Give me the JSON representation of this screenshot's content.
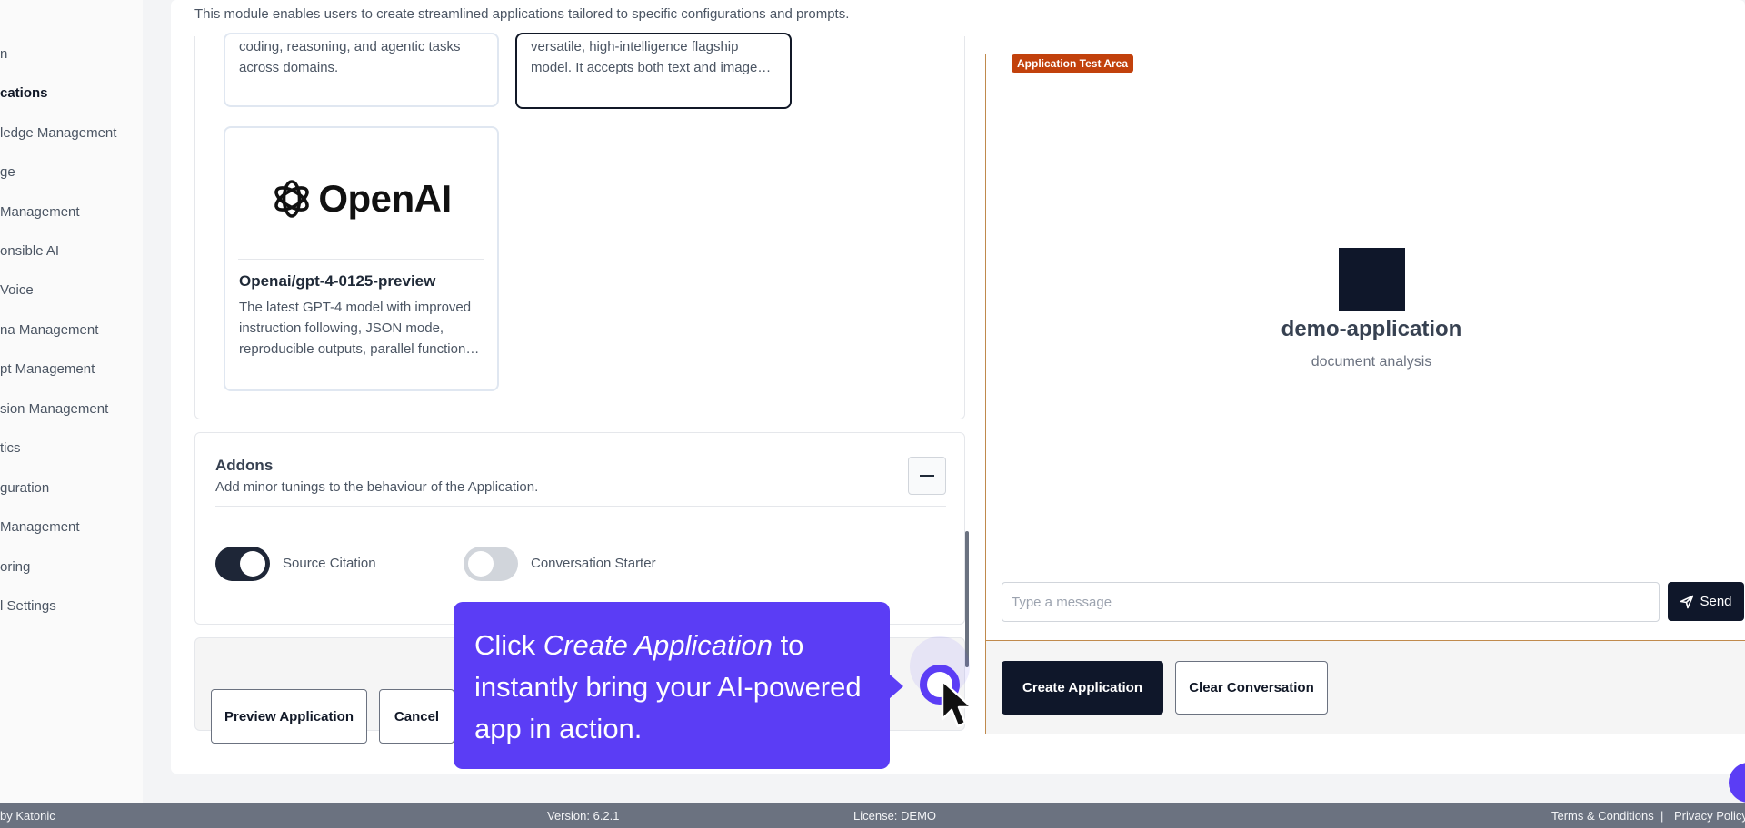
{
  "header": {
    "description": "This module enables users to create streamlined applications tailored to specific configurations and prompts."
  },
  "sidebar": {
    "items": [
      {
        "label": "n"
      },
      {
        "label": "cations"
      },
      {
        "label": "ledge Management"
      },
      {
        "label": "ge"
      },
      {
        "label": "Management"
      },
      {
        "label": "onsible AI"
      },
      {
        "label": "Voice"
      },
      {
        "label": "na Management"
      },
      {
        "label": "pt Management"
      },
      {
        "label": "sion Management"
      },
      {
        "label": "tics"
      },
      {
        "label": "guration"
      },
      {
        "label": "Management"
      },
      {
        "label": "oring"
      },
      {
        "label": "l Settings"
      }
    ]
  },
  "models": {
    "card1": {
      "line1": "coding, reasoning, and agentic tasks",
      "line2": "across domains."
    },
    "card2": {
      "line1": "versatile, high-intelligence flagship",
      "line2": "model. It accepts both text and image…"
    },
    "card3": {
      "logo_text": "OpenAI",
      "title": "Openai/gpt-4-0125-preview",
      "line1": "The latest GPT-4 model with improved",
      "line2": "instruction following, JSON mode,",
      "line3": "reproducible outputs, parallel function…"
    }
  },
  "addons": {
    "title": "Addons",
    "subtitle": "Add minor tunings to the behaviour of the Application.",
    "toggle1_label": "Source Citation",
    "toggle1_on": true,
    "toggle2_label": "Conversation Starter",
    "toggle2_on": false
  },
  "actions": {
    "preview_label": "Preview Application",
    "cancel_label": "Cancel"
  },
  "test_area": {
    "tag": "Application Test Area",
    "app_name": "demo-application",
    "app_description": "document analysis",
    "input_placeholder": "Type a message",
    "send_label": "Send",
    "create_label": "Create Application",
    "clear_label": "Clear Conversation"
  },
  "tooltip": {
    "prefix": "Click ",
    "emphasis": "Create Application",
    "suffix": " to instantly bring your AI-powered app in action."
  },
  "footer": {
    "left": "by Katonic",
    "version": "Version: 6.2.1",
    "license": "License: DEMO",
    "terms": "Terms & Conditions",
    "separator": "|",
    "privacy": "Privacy Policy"
  },
  "colors": {
    "accent": "#5b3df5",
    "dark": "#0f172a",
    "test_tag": "#c2410c"
  }
}
